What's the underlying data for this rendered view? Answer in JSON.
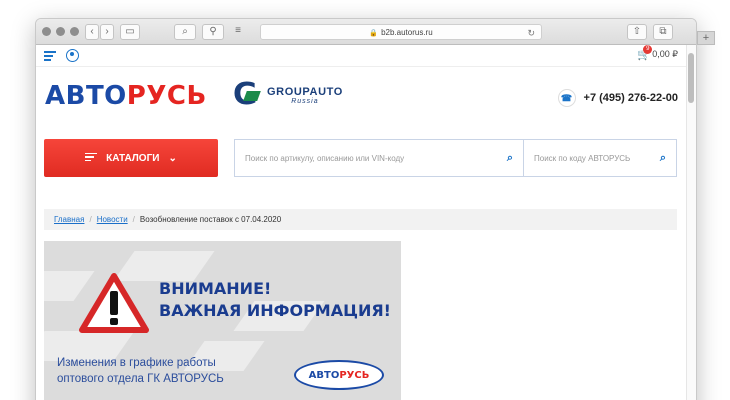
{
  "browser": {
    "url": "b2b.autorus.ru",
    "new_tab": "+"
  },
  "topbar": {
    "cart_count": "9",
    "cart_total": "0,00 ₽"
  },
  "header": {
    "logo_part1": "АВТО",
    "logo_part2": "РУСЬ",
    "partner_name": "GROUPAUTO",
    "partner_sub": "Russia",
    "phone": "+7 (495) 276-22-00"
  },
  "search": {
    "catalog_label": "КАТАЛОГИ",
    "main_placeholder": "Поиск по артикулу, описанию или VIN-коду",
    "code_placeholder": "Поиск по коду АВТОРУСЬ"
  },
  "breadcrumb": {
    "items": [
      "Главная",
      "Новости"
    ],
    "current": "Возобновление поставок с 07.04.2020"
  },
  "banner": {
    "title_line1": "ВНИМАНИЕ!",
    "title_line2": "ВАЖНАЯ ИНФОРМАЦИЯ!",
    "sub_line1": "Изменения в графике работы",
    "sub_line2": "оптового отдела ГК АВТОРУСЬ",
    "logo_part1": "АВТО",
    "logo_part2": "РУСЬ"
  },
  "colors": {
    "accent_blue": "#1a73c8",
    "logo_blue": "#1b4aa6",
    "logo_red": "#e52521",
    "catalog_red": "#e02b22"
  }
}
